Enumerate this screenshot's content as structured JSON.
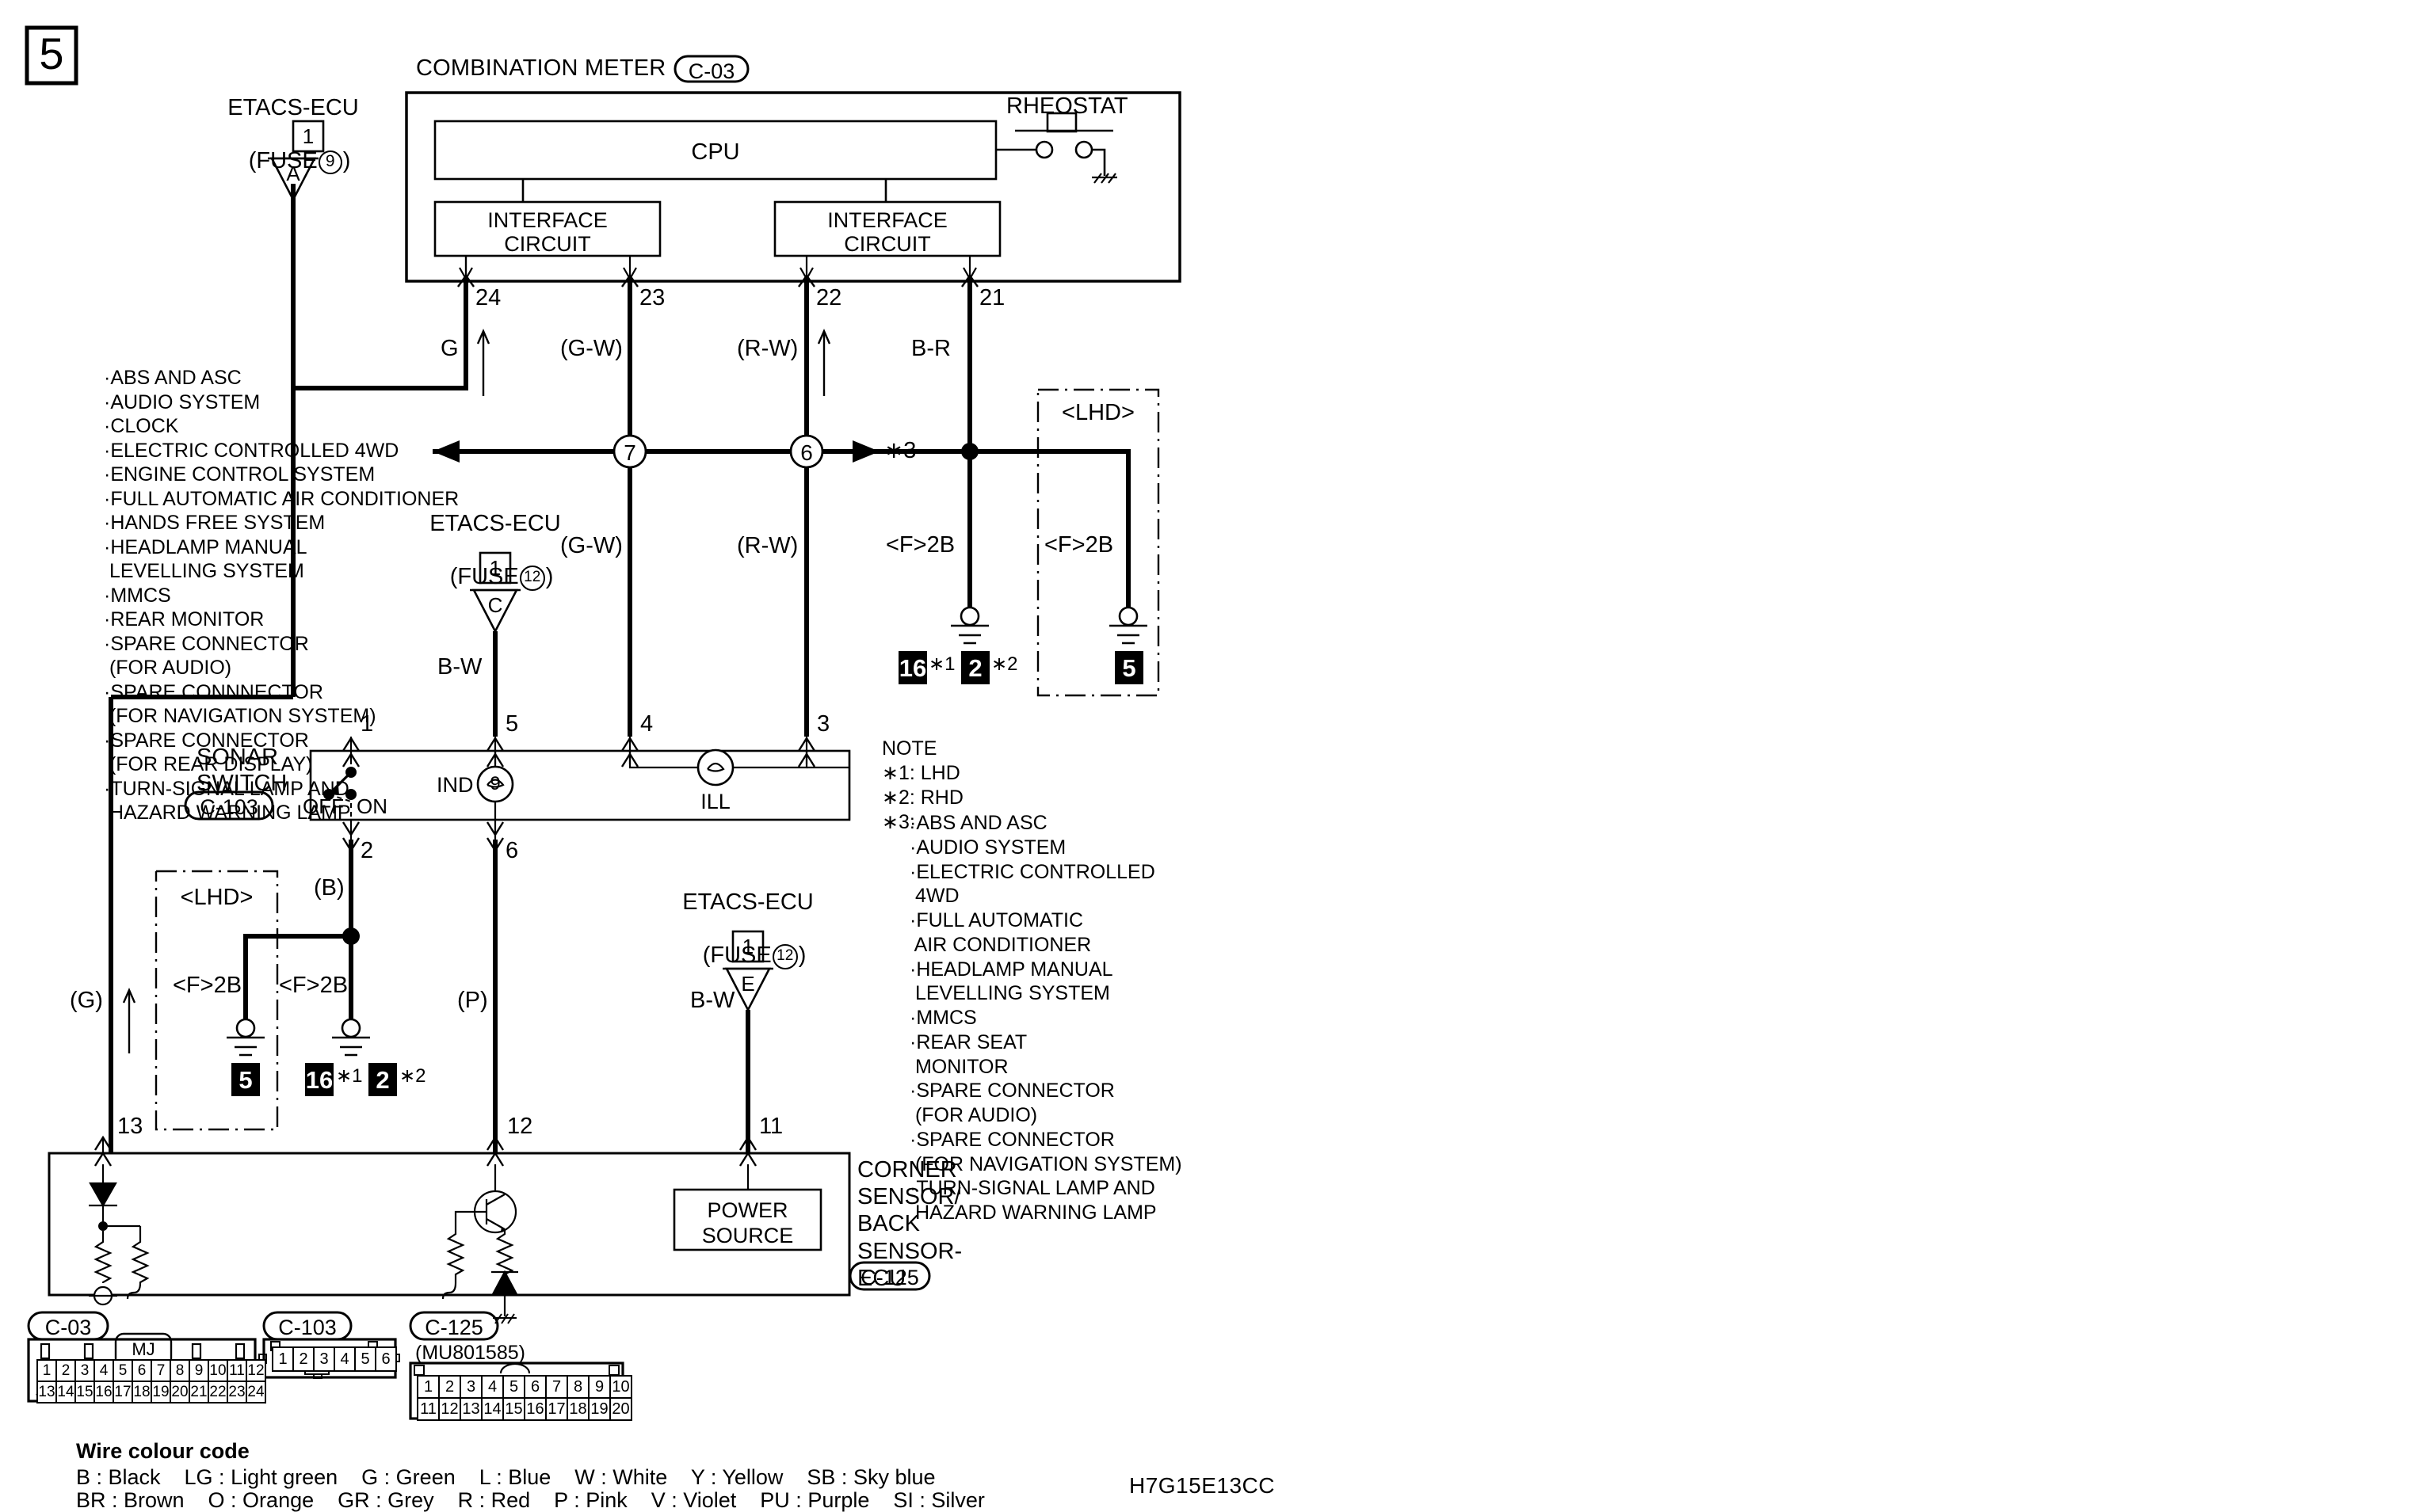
{
  "page": {
    "number": "5",
    "diagram_code": "H7G15E13CC"
  },
  "components": {
    "combination_meter": {
      "title": "COMBINATION METER",
      "connector": "C-03",
      "cpu": "CPU",
      "interface_left": "INTERFACE\nCIRCUIT",
      "interface_right": "INTERFACE\nCIRCUIT",
      "rheostat": "RHEOSTAT",
      "pins": [
        "24",
        "23",
        "22",
        "21"
      ]
    },
    "sonar_switch": {
      "title": "SONAR\nSWITCH",
      "connector": "C-103",
      "off_label": "OFF",
      "on_label": "ON",
      "ind_label": "IND",
      "ind_number": "9",
      "ill_label": "ILL",
      "pins_top": [
        "1",
        "5",
        "4",
        "3"
      ],
      "pins_bottom": [
        "2",
        "6"
      ]
    },
    "ecu": {
      "title": "CORNER\nSENSOR/\nBACK\nSENSOR-\nECU",
      "connector": "C-125",
      "power_source": "POWER\nSOURCE",
      "pins": [
        "13",
        "12",
        "11"
      ]
    },
    "fuses": [
      {
        "name": "ETACS-ECU",
        "fuse": "(FUSE⁨9⁩)",
        "fuse_text": "FUSE",
        "fuse_num": "9",
        "pin": "1",
        "letter": "A",
        "wire": "G"
      },
      {
        "name": "ETACS-ECU",
        "fuse_text": "FUSE",
        "fuse_num": "12",
        "pin": "1",
        "letter": "C",
        "wire": "B-W"
      },
      {
        "name": "ETACS-ECU",
        "fuse_text": "FUSE",
        "fuse_num": "12",
        "pin": "1",
        "letter": "E",
        "wire": "B-W"
      }
    ]
  },
  "wire_labels": {
    "w_g": "G",
    "w_gw_top": "(G-W)",
    "w_rw_top": "(R-W)",
    "w_br": "B-R",
    "w_gw_mid": "(G-W)",
    "w_rw_mid": "(R-W)",
    "w_bw_mid": "B-W",
    "w_b": "(B)",
    "w_g_left": "(G)",
    "w_p": "(P)",
    "w_bw_low": "B-W"
  },
  "splices": {
    "s7": "7",
    "s6": "6",
    "star3": "∗3"
  },
  "grounds": {
    "lhd_label": "<LHD>",
    "f2b": "<F>2B",
    "upper_right": [
      {
        "code": "16",
        "note": "∗1"
      },
      {
        "code": "2",
        "note": "∗2"
      },
      {
        "code": "5",
        "note": ""
      }
    ],
    "lower_left": [
      {
        "code": "5",
        "note": ""
      },
      {
        "code": "16",
        "note": "∗1"
      },
      {
        "code": "2",
        "note": "∗2"
      }
    ]
  },
  "systems_list": [
    "·ABS AND ASC",
    "·AUDIO SYSTEM",
    "·CLOCK",
    "·ELECTRIC CONTROLLED 4WD",
    "·ENGINE CONTROL SYSTEM",
    "·FULL AUTOMATIC AIR CONDITIONER",
    "·HANDS FREE SYSTEM",
    "·HEADLAMP MANUAL",
    " LEVELLING SYSTEM",
    "·MMCS",
    "·REAR MONITOR",
    "·SPARE CONNECTOR",
    " (FOR AUDIO)",
    "·SPARE CONNNECTOR",
    " (FOR NAVIGATION SYSTEM)",
    "·SPARE CONNECTOR",
    " (FOR REAR DISPLAY)",
    "·TURN-SIGNAL LAMP AND",
    " HAZARD WARNING LAMP"
  ],
  "note": {
    "title": "NOTE",
    "items": [
      "∗1: LHD",
      "∗2: RHD"
    ],
    "star3_prefix": "∗3:",
    "star3_list": [
      "·ABS AND ASC",
      "·AUDIO SYSTEM",
      "·ELECTRIC CONTROLLED",
      " 4WD",
      "·FULL AUTOMATIC",
      " AIR CONDITIONER",
      "·HEADLAMP MANUAL",
      " LEVELLING SYSTEM",
      "·MMCS",
      "·REAR SEAT",
      " MONITOR",
      "·SPARE CONNECTOR",
      " (FOR AUDIO)",
      "·SPARE CONNECTOR",
      " (FOR NAVIGATION SYSTEM)",
      "·TURN-SIGNAL LAMP AND",
      " HAZARD WARNING LAMP"
    ]
  },
  "connectors": [
    {
      "id": "C-03",
      "sub": "",
      "key_label": "MJ",
      "rows": [
        [
          "1",
          "2",
          "3",
          "4",
          "5",
          "6",
          "7",
          "8",
          "9",
          "10",
          "11",
          "12"
        ],
        [
          "13",
          "14",
          "15",
          "16",
          "17",
          "18",
          "19",
          "20",
          "21",
          "22",
          "23",
          "24"
        ]
      ]
    },
    {
      "id": "C-103",
      "sub": "",
      "key_label": "",
      "rows": [
        [
          "1",
          "2",
          "3",
          "4",
          "5",
          "6"
        ]
      ]
    },
    {
      "id": "C-125",
      "sub": "(MU801585)",
      "key_label": "",
      "rows": [
        [
          "1",
          "2",
          "3",
          "4",
          "5",
          "6",
          "7",
          "8",
          "9",
          "10"
        ],
        [
          "11",
          "12",
          "13",
          "14",
          "15",
          "16",
          "17",
          "18",
          "19",
          "20"
        ]
      ]
    }
  ],
  "legend": {
    "title": "Wire colour code",
    "row1": "B : Black    LG : Light green    G : Green    L : Blue    W : White    Y : Yellow    SB : Sky blue",
    "row2": "BR : Brown    O : Orange    GR : Grey    R : Red    P : Pink    V : Violet    PU : Purple    SI : Silver",
    "entries": [
      {
        "code": "B",
        "name": "Black"
      },
      {
        "code": "LG",
        "name": "Light green"
      },
      {
        "code": "G",
        "name": "Green"
      },
      {
        "code": "L",
        "name": "Blue"
      },
      {
        "code": "W",
        "name": "White"
      },
      {
        "code": "Y",
        "name": "Yellow"
      },
      {
        "code": "SB",
        "name": "Sky blue"
      },
      {
        "code": "BR",
        "name": "Brown"
      },
      {
        "code": "O",
        "name": "Orange"
      },
      {
        "code": "GR",
        "name": "Grey"
      },
      {
        "code": "R",
        "name": "Red"
      },
      {
        "code": "P",
        "name": "Pink"
      },
      {
        "code": "V",
        "name": "Violet"
      },
      {
        "code": "PU",
        "name": "Purple"
      },
      {
        "code": "SI",
        "name": "Silver"
      }
    ]
  }
}
